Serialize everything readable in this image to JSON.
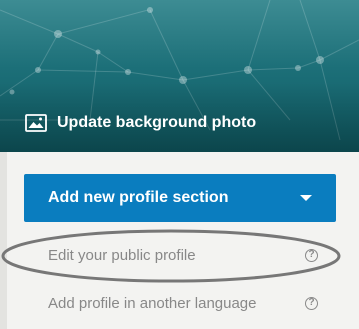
{
  "banner": {
    "update_photo_label": "Update background photo",
    "icon": "image-icon"
  },
  "actions": {
    "add_section_label": "Add new profile section",
    "add_section_icon": "chevron-down-icon",
    "edit_public_label": "Edit your public profile",
    "add_language_label": "Add profile in another language",
    "help_icon": "question-circle-icon"
  },
  "colors": {
    "banner_teal": "#1c6f78",
    "button_blue": "#0a7dbf",
    "link_gray": "#888888",
    "annotation_gray": "#777777"
  }
}
